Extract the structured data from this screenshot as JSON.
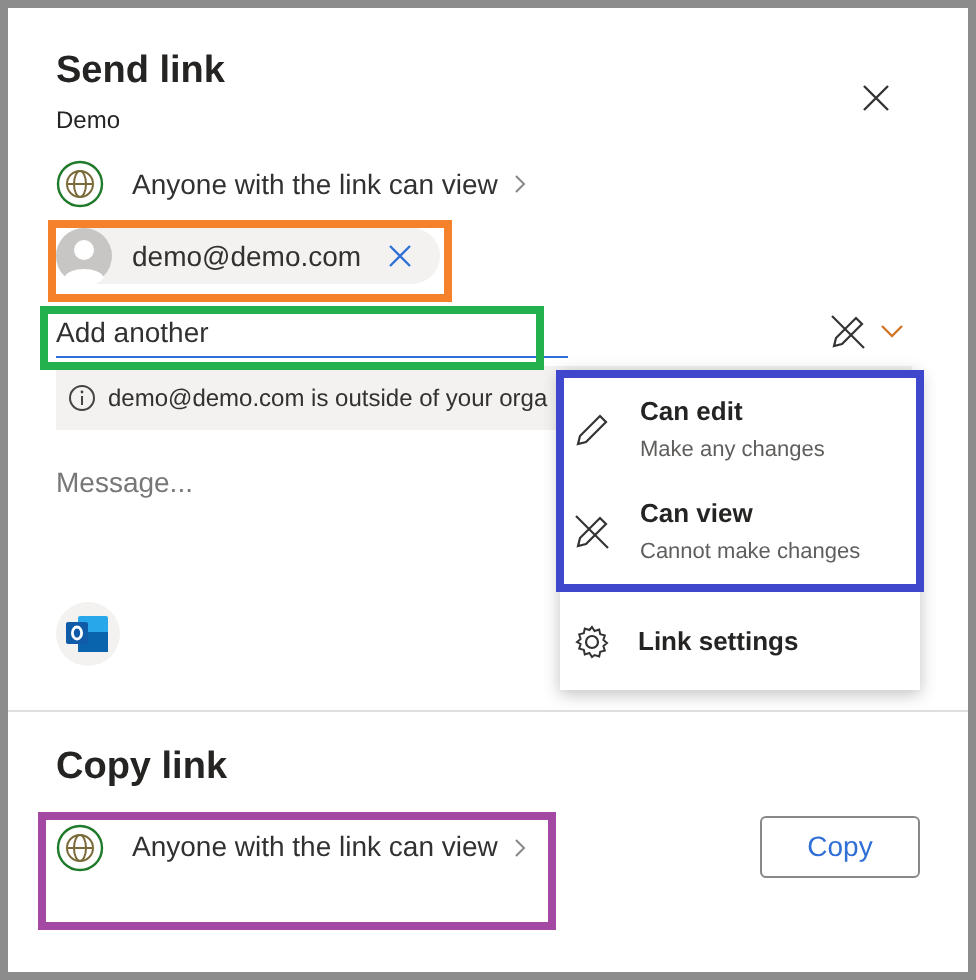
{
  "send_link": {
    "title": "Send link",
    "subtitle": "Demo",
    "link_scope": "Anyone with the link can view",
    "recipients": [
      {
        "email": "demo@demo.com"
      }
    ],
    "add_field": {
      "placeholder": "Add another"
    },
    "notice": "demo@demo.com is outside of your orga",
    "message": {
      "placeholder": "Message..."
    }
  },
  "permission_menu": {
    "items": [
      {
        "kind": "edit",
        "label": "Can edit",
        "description": "Make any changes"
      },
      {
        "kind": "view",
        "label": "Can view",
        "description": "Cannot make changes"
      },
      {
        "kind": "settings",
        "label": "Link settings"
      }
    ]
  },
  "copy_link": {
    "title": "Copy link",
    "link_scope": "Anyone with the link can view",
    "button": "Copy"
  }
}
